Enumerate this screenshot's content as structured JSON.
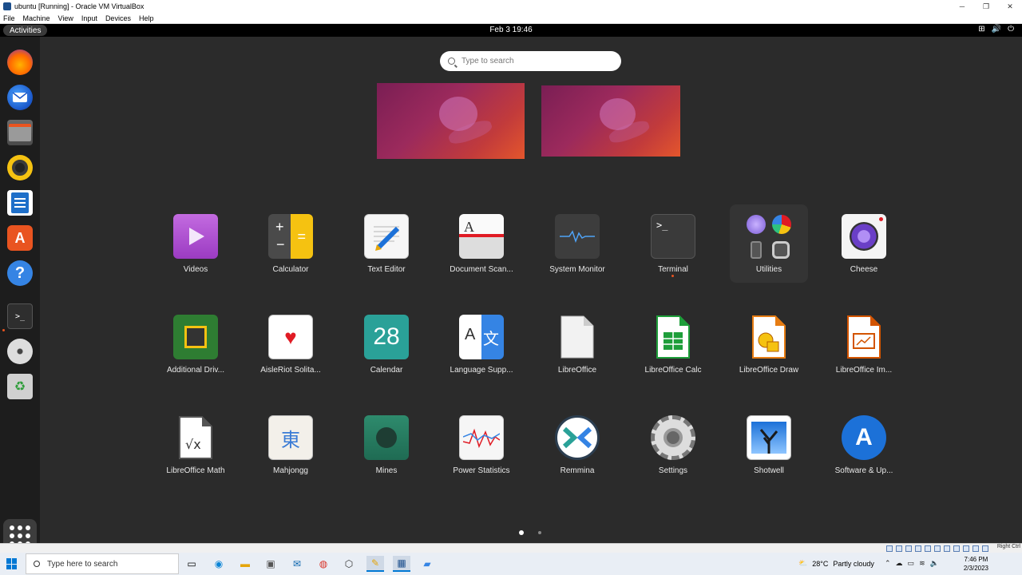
{
  "host": {
    "title": "ubuntu [Running] - Oracle VM VirtualBox",
    "menu": [
      "File",
      "Machine",
      "View",
      "Input",
      "Devices",
      "Help"
    ],
    "host_key": "Right Ctrl"
  },
  "topbar": {
    "activities": "Activities",
    "clock": "Feb 3  19:46"
  },
  "search": {
    "placeholder": "Type to search"
  },
  "dock": [
    "firefox-icon",
    "thunderbird-icon",
    "files-icon",
    "rhythmbox-icon",
    "libreoffice-writer-icon",
    "app-center-icon",
    "help-icon",
    "terminal-icon",
    "optical-disc-icon",
    "trash-icon"
  ],
  "apps": [
    {
      "label": "Videos"
    },
    {
      "label": "Calculator"
    },
    {
      "label": "Text Editor"
    },
    {
      "label": "Document Scan..."
    },
    {
      "label": "System Monitor"
    },
    {
      "label": "Terminal"
    },
    {
      "label": "Utilities"
    },
    {
      "label": "Cheese"
    },
    {
      "label": "Additional Driv..."
    },
    {
      "label": "AisleRiot Solita..."
    },
    {
      "label": "Calendar",
      "icon_text": "28"
    },
    {
      "label": "Language Supp...",
      "icon_text_left": "A",
      "icon_text_right": "文"
    },
    {
      "label": "LibreOffice"
    },
    {
      "label": "LibreOffice Calc"
    },
    {
      "label": "LibreOffice Draw"
    },
    {
      "label": "LibreOffice Im..."
    },
    {
      "label": "LibreOffice Math"
    },
    {
      "label": "Mahjongg",
      "icon_text": "東"
    },
    {
      "label": "Mines"
    },
    {
      "label": "Power Statistics"
    },
    {
      "label": "Remmina"
    },
    {
      "label": "Settings"
    },
    {
      "label": "Shotwell"
    },
    {
      "label": "Software & Up..."
    }
  ],
  "taskbar": {
    "search_placeholder": "Type here to search",
    "weather_temp": "28°C",
    "weather_text": "Partly cloudy",
    "time": "7:46 PM",
    "date": "2/3/2023"
  },
  "colors": {
    "ubuntu_orange": "#e95420",
    "topbar": "#000000",
    "overview_bg": "#2b2b2b"
  }
}
